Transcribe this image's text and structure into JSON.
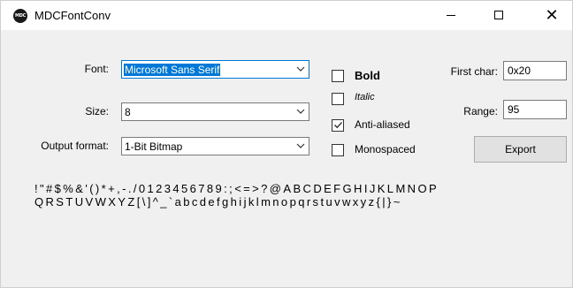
{
  "window": {
    "title": "MDCFontConv",
    "icon_text": "MDC",
    "minimize_icon": "minimize-icon",
    "maximize_icon": "maximize-icon",
    "close_glyph": "✕"
  },
  "form": {
    "font_label": "Font:",
    "font_value": "Microsoft Sans Serif",
    "size_label": "Size:",
    "size_value": "8",
    "output_label": "Output format:",
    "output_value": "1-Bit Bitmap",
    "bold_label": "Bold",
    "bold_checked": false,
    "italic_label": "Italic",
    "italic_checked": false,
    "antialiased_label": "Anti-aliased",
    "antialiased_checked": true,
    "monospaced_label": "Monospaced",
    "monospaced_checked": false,
    "first_char_label": "First char:",
    "first_char_value": "0x20",
    "range_label": "Range:",
    "range_value": "95",
    "export_label": "Export"
  },
  "preview": {
    "line1": "!\"#$%&'()*+,-./0123456789:;<=>?@ABCDEFGHIJKLMNOP",
    "line2": "QRSTUVWXYZ[\\]^_`abcdefghijklmnopqrstuvwxyz{|}~"
  },
  "colors": {
    "accent": "#0078d7",
    "window_bg": "#f0f0f0",
    "button_bg": "#e1e1e1"
  }
}
